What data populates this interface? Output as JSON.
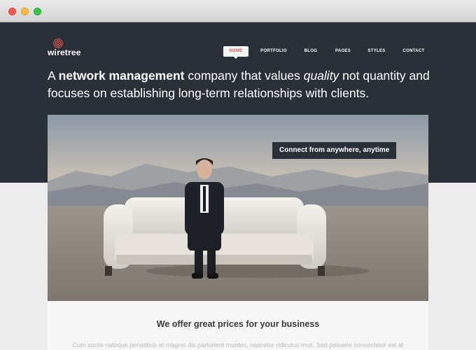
{
  "logo": {
    "text": "wiretree",
    "icon": "spiral-logo-icon",
    "accent": "#d9534f"
  },
  "nav": {
    "items": [
      {
        "label": "HOME",
        "active": true
      },
      {
        "label": "PORTFOLIO",
        "active": false
      },
      {
        "label": "BLOG",
        "active": false
      },
      {
        "label": "PAGES",
        "active": false
      },
      {
        "label": "STYLES",
        "active": false
      },
      {
        "label": "CONTACT",
        "active": false
      }
    ]
  },
  "headline": {
    "p1": "A ",
    "bold": "network management",
    "p2": " company that values ",
    "italic": "quality",
    "p3": " not quantity and focuses on establishing long-term relationships with clients."
  },
  "hero_image": {
    "caption": "Connect from anywhere, anytime",
    "description_icon": "man-on-sofa-photo"
  },
  "content": {
    "title": "We offer great prices for your business",
    "body": "Cum sociis natoque penatibus et magnis dis parturient montes, nascetur ridiculus mus. Sed posuere consectetur est at"
  },
  "colors": {
    "header_bg": "#2a3038",
    "active_nav_text": "#d9534f",
    "page_bg": "#e9e9e9"
  }
}
